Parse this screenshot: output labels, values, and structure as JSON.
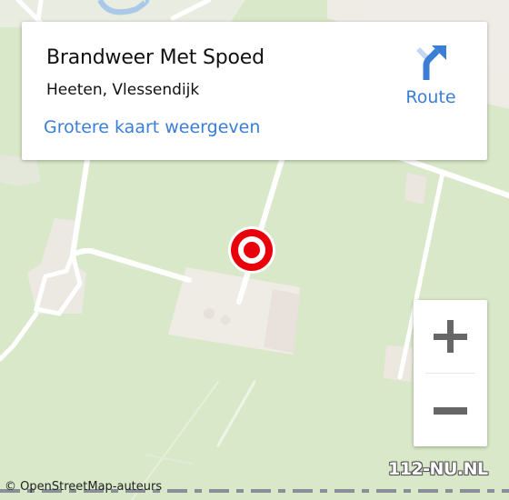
{
  "info_card": {
    "title": "Brandweer Met Spoed",
    "address": "Heeten, Vlessendijk",
    "bigger_map_link": "Grotere kaart weergeven",
    "route_label": "Route",
    "route_icon": "directions-turn-right-icon"
  },
  "map": {
    "marker_icon": "target-marker-icon",
    "colors": {
      "land": "#d8e8c8",
      "built_area": "#efece6",
      "road": "#ffffff",
      "marker_red": "#e8000a",
      "water": "#aac8e8",
      "link_blue": "#3a7fd5"
    }
  },
  "zoom_controls": {
    "zoom_in_symbol": "+",
    "zoom_out_symbol": "−"
  },
  "attribution": "© OpenStreetMap-auteurs",
  "watermark": "112-NU.NL"
}
